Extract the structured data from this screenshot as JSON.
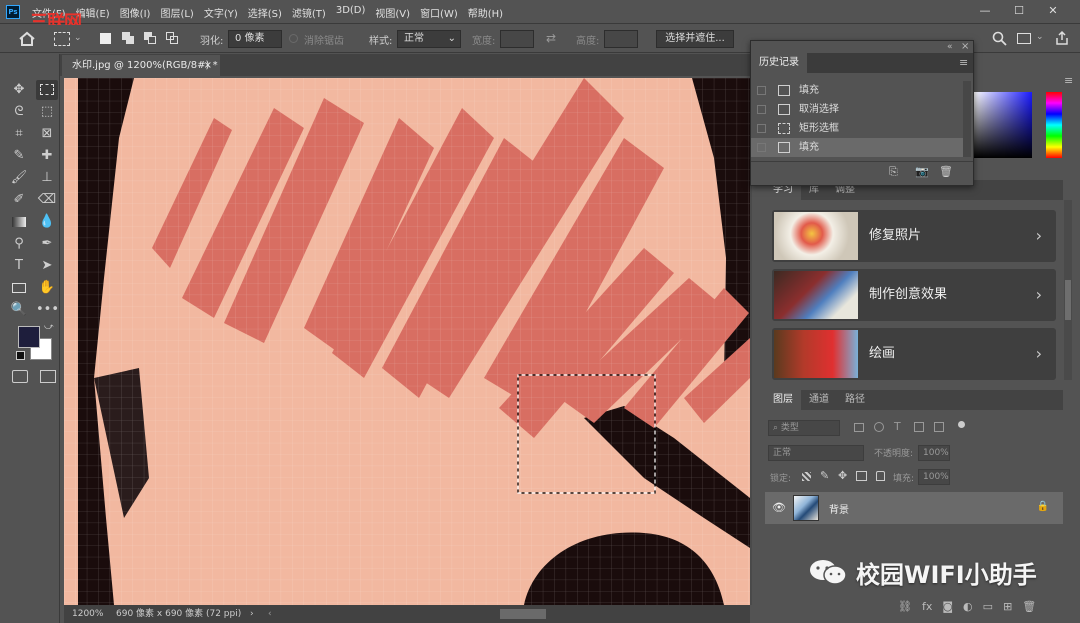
{
  "app": {
    "logo_text": "Ps",
    "brand_overlay": "三联网"
  },
  "menu": [
    "文件(F)",
    "编辑(E)",
    "图像(I)",
    "图层(L)",
    "文字(Y)",
    "选择(S)",
    "滤镜(T)",
    "3D(D)",
    "视图(V)",
    "窗口(W)",
    "帮助(H)"
  ],
  "window_buttons": {
    "minimize": "—",
    "restore": "☐",
    "close": "✕"
  },
  "options": {
    "feather_label": "羽化:",
    "feather_value": "0 像素",
    "antialias_label": "消除锯齿",
    "style_label": "样式:",
    "style_value": "正常",
    "width_label": "宽度:",
    "height_label": "高度:",
    "select_mask_button": "选择并遮住..."
  },
  "document": {
    "tab_title": "水印.jpg @ 1200%(RGB/8#) *",
    "close": "×"
  },
  "status": {
    "zoom": "1200%",
    "info": "690 像素 x 690 像素 (72 ppi)"
  },
  "history": {
    "title": "历史记录",
    "items": [
      {
        "label": "填充",
        "current": false
      },
      {
        "label": "取消选择",
        "current": false
      },
      {
        "label": "矩形选框",
        "current": false
      },
      {
        "label": "填充",
        "current": true
      }
    ]
  },
  "learn": {
    "tabs": [
      "学习",
      "库",
      "调整"
    ],
    "cards": [
      {
        "label": "修复照片"
      },
      {
        "label": "制作创意效果"
      },
      {
        "label": "绘画"
      }
    ]
  },
  "layers": {
    "tabs": [
      "图层",
      "通道",
      "路径"
    ],
    "filter_placeholder": "类型",
    "blend_mode": "正常",
    "opacity_label": "不透明度:",
    "opacity_value": "100%",
    "lock_label": "锁定:",
    "fill_label": "填充:",
    "fill_value": "100%",
    "items": [
      {
        "name": "背景",
        "visible": true,
        "locked": true
      }
    ]
  },
  "watermark_text": "校园WIFI小助手",
  "colors": {
    "foreground": "#1e1e3c",
    "background": "#ffffff",
    "canvas_skin": "#f2b8a0",
    "stripe": "#d86e62",
    "accent": "#31a8ff"
  }
}
